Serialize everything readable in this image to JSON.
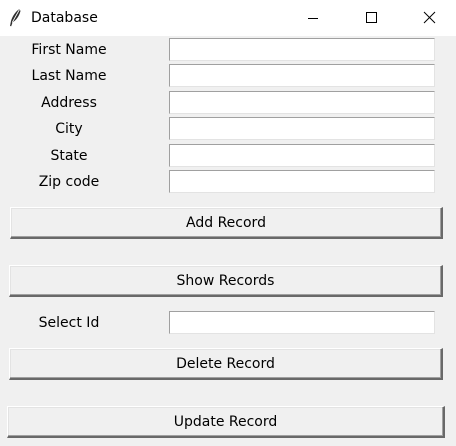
{
  "window": {
    "title": "Database",
    "app_icon": "feather-icon",
    "controls": {
      "minimize_icon": "minimize-icon",
      "maximize_icon": "maximize-icon",
      "close_icon": "close-icon"
    }
  },
  "form": {
    "first_name": {
      "label": "First Name",
      "value": ""
    },
    "last_name": {
      "label": "Last Name",
      "value": ""
    },
    "address": {
      "label": "Address",
      "value": ""
    },
    "city": {
      "label": "City",
      "value": ""
    },
    "state": {
      "label": "State",
      "value": ""
    },
    "zip_code": {
      "label": "Zip code",
      "value": ""
    }
  },
  "buttons": {
    "add_record": "Add Record",
    "show_records": "Show Records",
    "delete_record": "Delete Record",
    "update_record": "Update Record"
  },
  "select_id": {
    "label": "Select Id",
    "value": ""
  }
}
